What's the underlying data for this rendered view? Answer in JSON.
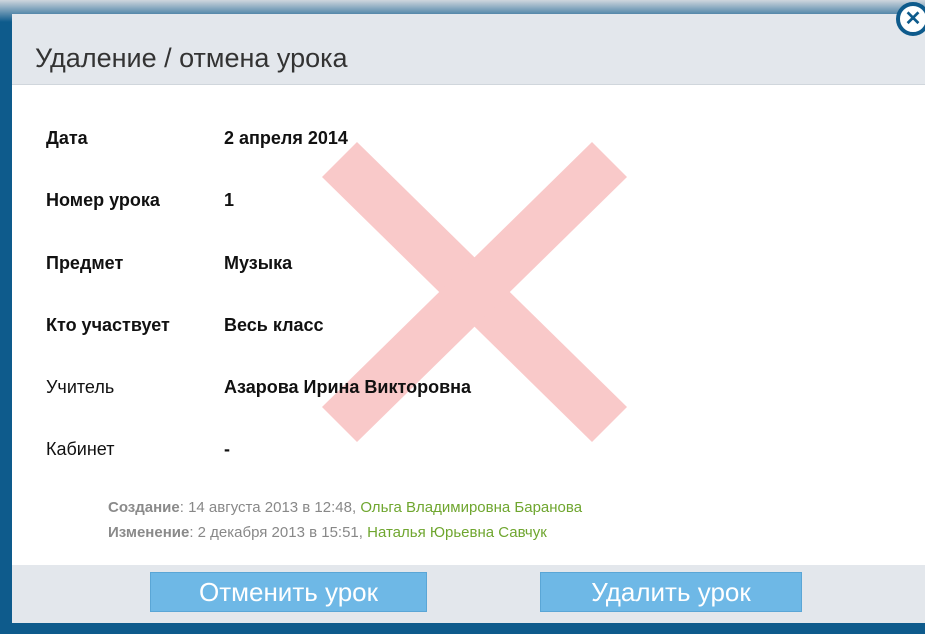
{
  "dialog": {
    "title": "Удаление / отмена урока",
    "close_glyph": "✕"
  },
  "fields": [
    {
      "label": "Дата",
      "value": "2 апреля 2014"
    },
    {
      "label": "Номер урока",
      "value": "1"
    },
    {
      "label": "Предмет",
      "value": "Музыка"
    },
    {
      "label": "Кто участвует",
      "value": "Весь класс"
    },
    {
      "label": "Учитель",
      "value": "Азарова Ирина Викторовна"
    },
    {
      "label": "Кабинет",
      "value": "-"
    }
  ],
  "history": {
    "created_label": "Создание",
    "created_text": ": 14 августа 2013 в 12:48, ",
    "created_by": "Ольга Владимировна Баранова",
    "changed_label": "Изменение",
    "changed_text": ": 2 декабря 2013 в 15:51, ",
    "changed_by": "Наталья Юрьевна Савчук"
  },
  "buttons": {
    "cancel_lesson": "Отменить урок",
    "delete_lesson": "Удалить урок"
  },
  "colors": {
    "frame": "#0e5b8c",
    "header_bg": "#e3e7ec",
    "button": "#6eb8e6",
    "watermark_x": "#f9c9c9",
    "author_link": "#6fa62f"
  },
  "icons": {
    "close": "close-icon",
    "watermark": "cross-mark-icon"
  }
}
